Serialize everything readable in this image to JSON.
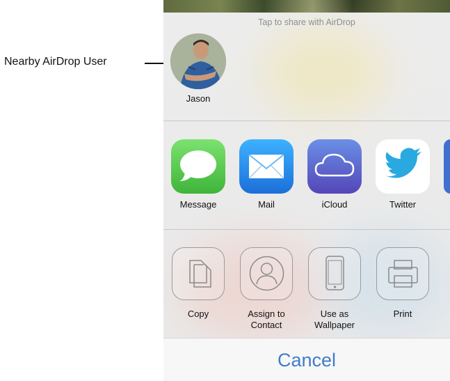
{
  "callout": {
    "label": "Nearby AirDrop User"
  },
  "airdrop": {
    "hint": "Tap to share with AirDrop",
    "person": {
      "name": "Jason"
    }
  },
  "apps": [
    {
      "label": "Message",
      "icon": "message-icon",
      "color": "#5fd05a"
    },
    {
      "label": "Mail",
      "icon": "mail-icon",
      "color": "#2a8df0"
    },
    {
      "label": "iCloud",
      "icon": "icloud-icon",
      "color": "#5d6ad6"
    },
    {
      "label": "Twitter",
      "icon": "twitter-icon",
      "color": "#2aa9e0"
    }
  ],
  "actions": [
    {
      "label": "Copy",
      "icon": "copy-icon"
    },
    {
      "label": "Assign to Contact",
      "icon": "contact-icon"
    },
    {
      "label": "Use as Wallpaper",
      "icon": "wallpaper-icon"
    },
    {
      "label": "Print",
      "icon": "print-icon"
    }
  ],
  "cancel": {
    "label": "Cancel",
    "color": "#3f7ec7"
  }
}
